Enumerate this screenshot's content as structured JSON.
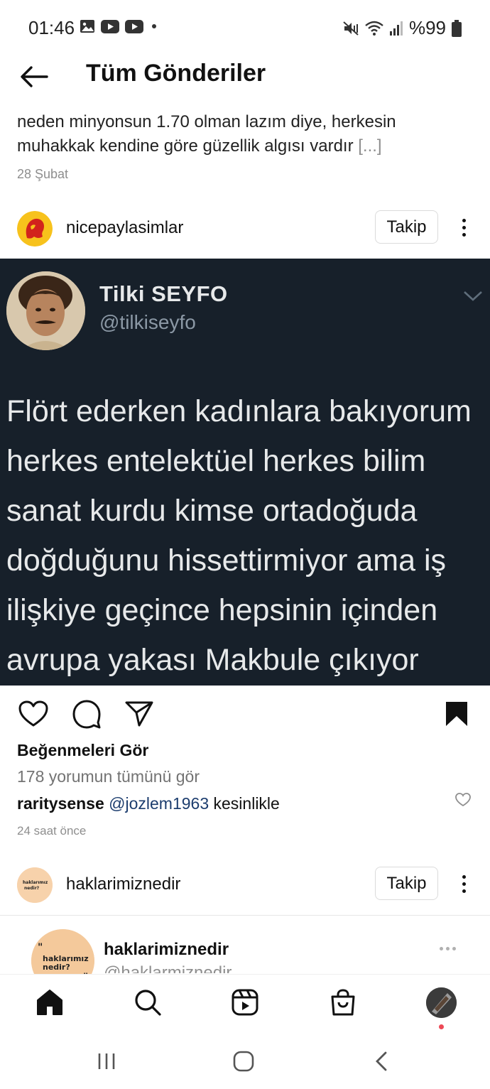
{
  "status_bar": {
    "time": "01:46",
    "battery": "%99",
    "left_icons": [
      "image-icon",
      "youtube-icon",
      "youtube-icon",
      "dot-icon"
    ],
    "right_icons": [
      "mute-vibrate-icon",
      "wifi-icon",
      "signal-icon",
      "battery-icon"
    ]
  },
  "header": {
    "title": "Tüm Gönderiler",
    "back_icon": "arrow-left-icon"
  },
  "previous_post": {
    "caption_line1": "neden minyonsun 1.70 olman lazım diye, herkesin",
    "caption_line2": "muhakkak kendine göre güzellik algısı vardır",
    "more_label": "[...]",
    "date": "28 Şubat"
  },
  "post": {
    "username": "nicepaylasimlar",
    "follow_label": "Takip",
    "tweet": {
      "name": "Tilki SEYFO",
      "handle": "@tilkiseyfo",
      "lines": [
        "Flört ederken kadınlara bakıyorum",
        "herkes entelektüel herkes bilim",
        "sanat kurdu kimse ortadoğuda",
        "doğduğunu hissettirmiyor ama iş",
        "ilişkiye geçince hepsinin içinden",
        "avrupa yakası Makbule çıkıyor"
      ]
    },
    "likes_label": "Beğenmeleri Gör",
    "all_comments_label": "178 yorumun tümünü gör",
    "comment": {
      "user": "raritysense",
      "mention": "@jozlem1963",
      "text": " kesinlikle"
    },
    "time_ago": "24 saat önce"
  },
  "next_post": {
    "username": "haklarimiznedir",
    "follow_label": "Takip",
    "avatar_text_1": "haklarımız",
    "avatar_text_2": "nedir?",
    "embed_name": "haklarimiznedir",
    "embed_handle": "@haklarmiznedir"
  },
  "bottom_nav": [
    "home-icon",
    "search-icon",
    "reels-icon",
    "shop-icon",
    "profile-avatar"
  ],
  "colors": {
    "tweet_bg": "#17202a",
    "tweet_text": "#e7e9ea",
    "muted": "#8e8e8e",
    "notification": "#ed4956"
  }
}
